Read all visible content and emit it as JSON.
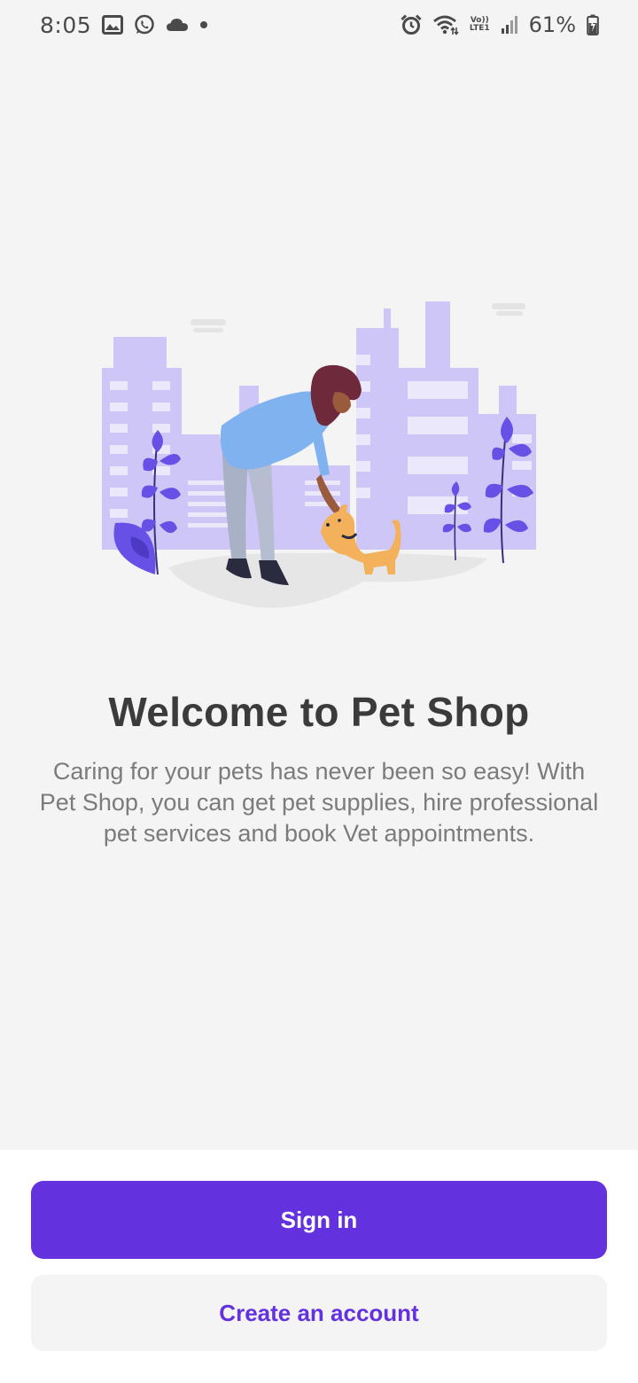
{
  "status_bar": {
    "time": "8:05",
    "battery_percent": "61%",
    "lte_label_top": "Vo))",
    "lte_label_bottom": "LTE1",
    "icons": [
      "image-icon",
      "whatsapp-icon",
      "cloud-icon",
      "dot-icon",
      "alarm-icon",
      "wifi-icon",
      "lte-icon",
      "signal-icon",
      "battery-icon"
    ]
  },
  "illustration": {
    "name": "woman-petting-dog-illustration",
    "colors": {
      "buildings": "#cdc6f6",
      "leaves": "#6650e6",
      "dog": "#f3b15c",
      "shirt": "#7fb2ef",
      "hair": "#6e2a3a",
      "ground": "#e6e6e6"
    }
  },
  "content": {
    "title": "Welcome to Pet Shop",
    "description": "Caring for your pets has never been so easy! With Pet Shop, you can get pet supplies, hire professional pet services and book Vet appointments."
  },
  "actions": {
    "sign_in_label": "Sign in",
    "create_account_label": "Create an account"
  },
  "theme": {
    "accent": "#6331dd",
    "background": "#f4f4f4"
  }
}
